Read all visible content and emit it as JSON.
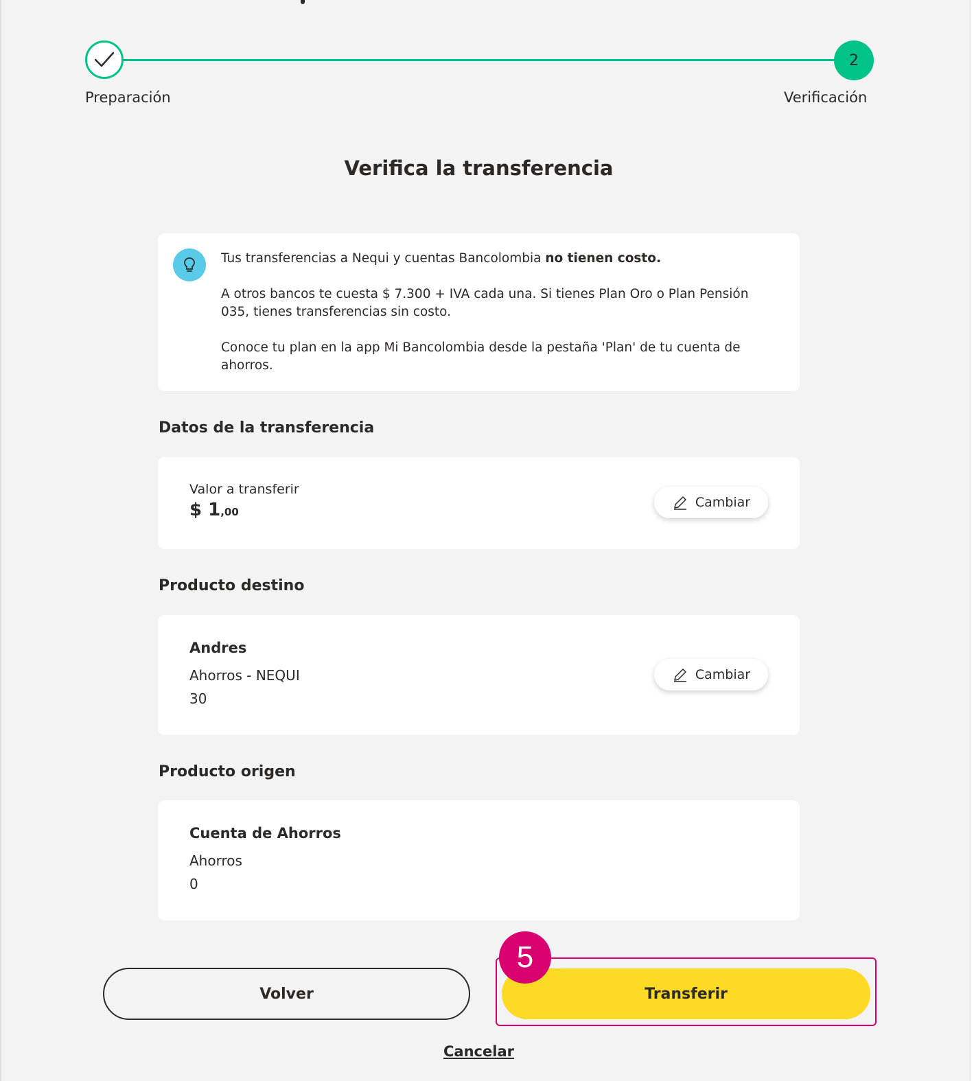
{
  "stepper": {
    "step1_label": "Preparación",
    "step2_number": "2",
    "step2_label": "Verificación"
  },
  "page_title": "Verifica la transferencia",
  "info": {
    "line1_regular": "Tus transferencias a Nequi y cuentas Bancolombia ",
    "line1_bold": "no tienen costo.",
    "paragraph2": "A otros bancos te cuesta $ 7.300 + IVA cada una. Si tienes Plan Oro o Plan Pensión 035, tienes transferencias sin costo.",
    "paragraph3": "Conoce tu plan en la app Mi Bancolombia desde la pestaña 'Plan' de tu cuenta de ahorros."
  },
  "transfer_data": {
    "section_title": "Datos de la transferencia",
    "amount_label": "Valor a transferir",
    "amount_main": "$ 1",
    "amount_cents": ",00",
    "change_label": "Cambiar"
  },
  "destination": {
    "section_title": "Producto destino",
    "name": "Andres",
    "type": "Ahorros - NEQUI",
    "number": "30",
    "change_label": "Cambiar"
  },
  "origin": {
    "section_title": "Producto origen",
    "name": "Cuenta de Ahorros",
    "type": "Ahorros",
    "number": "0"
  },
  "actions": {
    "back_label": "Volver",
    "transfer_label": "Transferir",
    "cancel_label": "Cancelar",
    "step_badge": "5"
  },
  "colors": {
    "accent_green": "#00c389",
    "primary_yellow": "#fdda24",
    "highlight_magenta": "#d9006f",
    "info_blue": "#59cbe8"
  }
}
